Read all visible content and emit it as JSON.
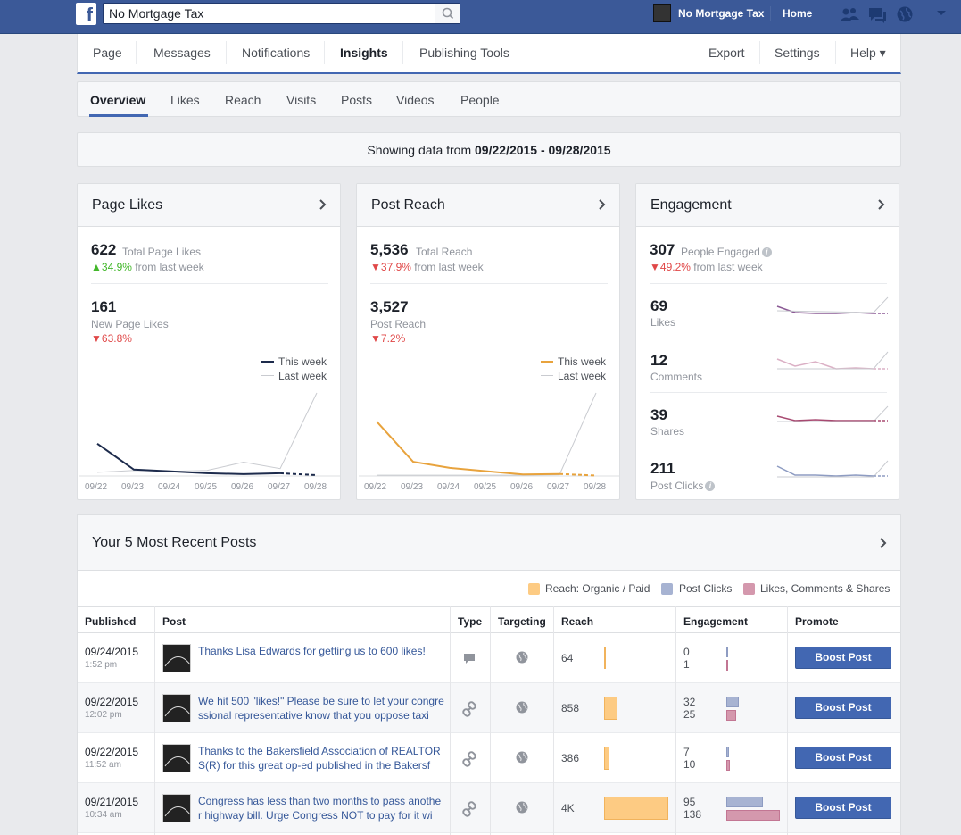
{
  "topbar": {
    "search_value": "No Mortgage Tax",
    "page_name": "No Mortgage Tax",
    "home_label": "Home"
  },
  "page_nav": {
    "items": [
      "Page",
      "Messages",
      "Notifications",
      "Insights",
      "Publishing Tools"
    ],
    "active": "Insights",
    "right_items": [
      "Export",
      "Settings",
      "Help ▾"
    ]
  },
  "sub_nav": {
    "items": [
      "Overview",
      "Likes",
      "Reach",
      "Visits",
      "Posts",
      "Videos",
      "People"
    ],
    "active": "Overview"
  },
  "date_range": {
    "prefix": "Showing data from",
    "range": "09/22/2015 - 09/28/2015"
  },
  "cards": {
    "page_likes": {
      "title": "Page Likes",
      "total": "622",
      "total_label": "Total Page Likes",
      "total_delta": "34.9%",
      "total_delta_dir": "up",
      "delta_suffix": "from last week",
      "sub_value": "161",
      "sub_label": "New Page Likes",
      "sub_delta": "63.8%",
      "legend_this": "This week",
      "legend_last": "Last week",
      "this_color": "#1d2b4c"
    },
    "post_reach": {
      "title": "Post Reach",
      "total": "5,536",
      "total_label": "Total Reach",
      "total_delta": "37.9%",
      "delta_suffix": "from last week",
      "sub_value": "3,527",
      "sub_label": "Post Reach",
      "sub_delta": "7.2%",
      "legend_this": "This week",
      "legend_last": "Last week",
      "this_color": "#e8a33d"
    },
    "engagement": {
      "title": "Engagement",
      "total": "307",
      "total_label": "People Engaged",
      "total_delta": "49.2%",
      "delta_suffix": "from last week",
      "rows": [
        {
          "value": "69",
          "label": "Likes"
        },
        {
          "value": "12",
          "label": "Comments"
        },
        {
          "value": "39",
          "label": "Shares"
        },
        {
          "value": "211",
          "label": "Post Clicks"
        }
      ]
    }
  },
  "chart_data": [
    {
      "type": "line",
      "title": "Page Likes",
      "x": [
        "09/22",
        "09/23",
        "09/24",
        "09/25",
        "09/26",
        "09/27",
        "09/28"
      ],
      "series": [
        {
          "name": "This week",
          "values": [
            35,
            7,
            5,
            3,
            2,
            3,
            1
          ]
        },
        {
          "name": "Last week",
          "values": [
            4,
            6,
            5,
            6,
            15,
            8,
            90
          ]
        }
      ]
    },
    {
      "type": "line",
      "title": "Post Reach",
      "x": [
        "09/22",
        "09/23",
        "09/24",
        "09/25",
        "09/26",
        "09/27",
        "09/28"
      ],
      "series": [
        {
          "name": "This week",
          "values": [
            1350,
            350,
            200,
            120,
            40,
            50,
            10
          ]
        },
        {
          "name": "Last week",
          "values": [
            20,
            20,
            20,
            20,
            20,
            30,
            2050
          ]
        }
      ]
    }
  ],
  "posts": {
    "title": "Your 5 Most Recent Posts",
    "legend": [
      "Reach: Organic / Paid",
      "Post Clicks",
      "Likes, Comments & Shares"
    ],
    "legend_colors": [
      "#fdcb83",
      "#a7b3d2",
      "#d498ad"
    ],
    "headers": [
      "Published",
      "Post",
      "Type",
      "Targeting",
      "Reach",
      "Engagement",
      "Promote"
    ],
    "boost_label": "Boost Post",
    "rows": [
      {
        "date": "09/24/2015",
        "time": "1:52 pm",
        "text": "Thanks Lisa Edwards for getting us to 600 likes!",
        "type_icon": "status-icon",
        "reach": "64",
        "reach_frac": 0.02,
        "clicks": "0",
        "likes": "1",
        "clicks_frac": 0.0,
        "likes_frac": 0.01
      },
      {
        "date": "09/22/2015",
        "time": "12:02 pm",
        "text": "We hit 500 \"likes!\" Please be sure to let your congressional representative know that you oppose taxi",
        "type_icon": "link-icon",
        "reach": "858",
        "reach_frac": 0.21,
        "clicks": "32",
        "likes": "25",
        "clicks_frac": 0.23,
        "likes_frac": 0.18
      },
      {
        "date": "09/22/2015",
        "time": "11:52 am",
        "text": "Thanks to the Bakersfield Association of REALTORS(R) for this great op-ed published in the Bakersf",
        "type_icon": "link-icon",
        "reach": "386",
        "reach_frac": 0.09,
        "clicks": "7",
        "likes": "10",
        "clicks_frac": 0.05,
        "likes_frac": 0.07
      },
      {
        "date": "09/21/2015",
        "time": "10:34 am",
        "text": "Congress has less than two months to pass another highway bill. Urge Congress NOT to pay for it wi",
        "type_icon": "link-icon",
        "reach": "4K",
        "reach_frac": 1.0,
        "clicks": "95",
        "likes": "138",
        "clicks_frac": 0.69,
        "likes_frac": 1.0
      }
    ]
  }
}
